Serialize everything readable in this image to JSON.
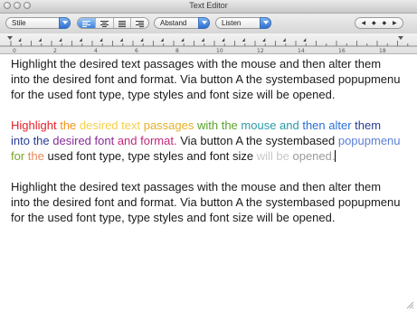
{
  "window": {
    "title": "Text Editor"
  },
  "toolbar": {
    "style_popup": "Stile",
    "spacing_popup": "Abstand",
    "lists_popup": "Listen",
    "nav": [
      "◀",
      "◆",
      "◆",
      "▶"
    ]
  },
  "ruler": {
    "labels": [
      "0",
      "2",
      "4",
      "6",
      "8",
      "10",
      "12",
      "14",
      "16",
      "18"
    ]
  },
  "paragraphs": {
    "p1": "Highlight the desired text passages with the mouse and then alter them into the desired font and format. Via button A the systembased popupmenu for the used font type, type styles and font size will be opened.",
    "p2_segments": [
      {
        "text": "Highlight ",
        "color": "#e8202a"
      },
      {
        "text": "the ",
        "color": "#f0941b"
      },
      {
        "text": "desired text ",
        "color": "#f4d14a"
      },
      {
        "text": "passages ",
        "color": "#e6b023"
      },
      {
        "text": "with the ",
        "color": "#5aa42b"
      },
      {
        "text": "mouse and ",
        "color": "#2a9aa6"
      },
      {
        "text": "then alter ",
        "color": "#2a6fd6"
      },
      {
        "text": "them into the ",
        "color": "#283c96"
      },
      {
        "text": "desired font ",
        "color": "#8a2a9a"
      },
      {
        "text": "and format. ",
        "color": "#c2287a"
      },
      {
        "text": "Via button A the systembased ",
        "color": "#1a1a1a"
      },
      {
        "text": "popupmenu ",
        "color": "#5b7fd6"
      },
      {
        "text": "for ",
        "color": "#7aa52b"
      },
      {
        "text": "the ",
        "color": "#e58a5a"
      },
      {
        "text": "used font type, type styles and font size ",
        "color": "#1a1a1a"
      },
      {
        "text": "will be ",
        "color": "#c8c8c8"
      },
      {
        "text": "opened.",
        "color": "#9a9a9a"
      }
    ],
    "p3": "Highlight the desired text passages with the mouse and then alter them into the desired font and format. Via button A the systembased popupmenu for the used font type, type styles and font size will be opened."
  }
}
